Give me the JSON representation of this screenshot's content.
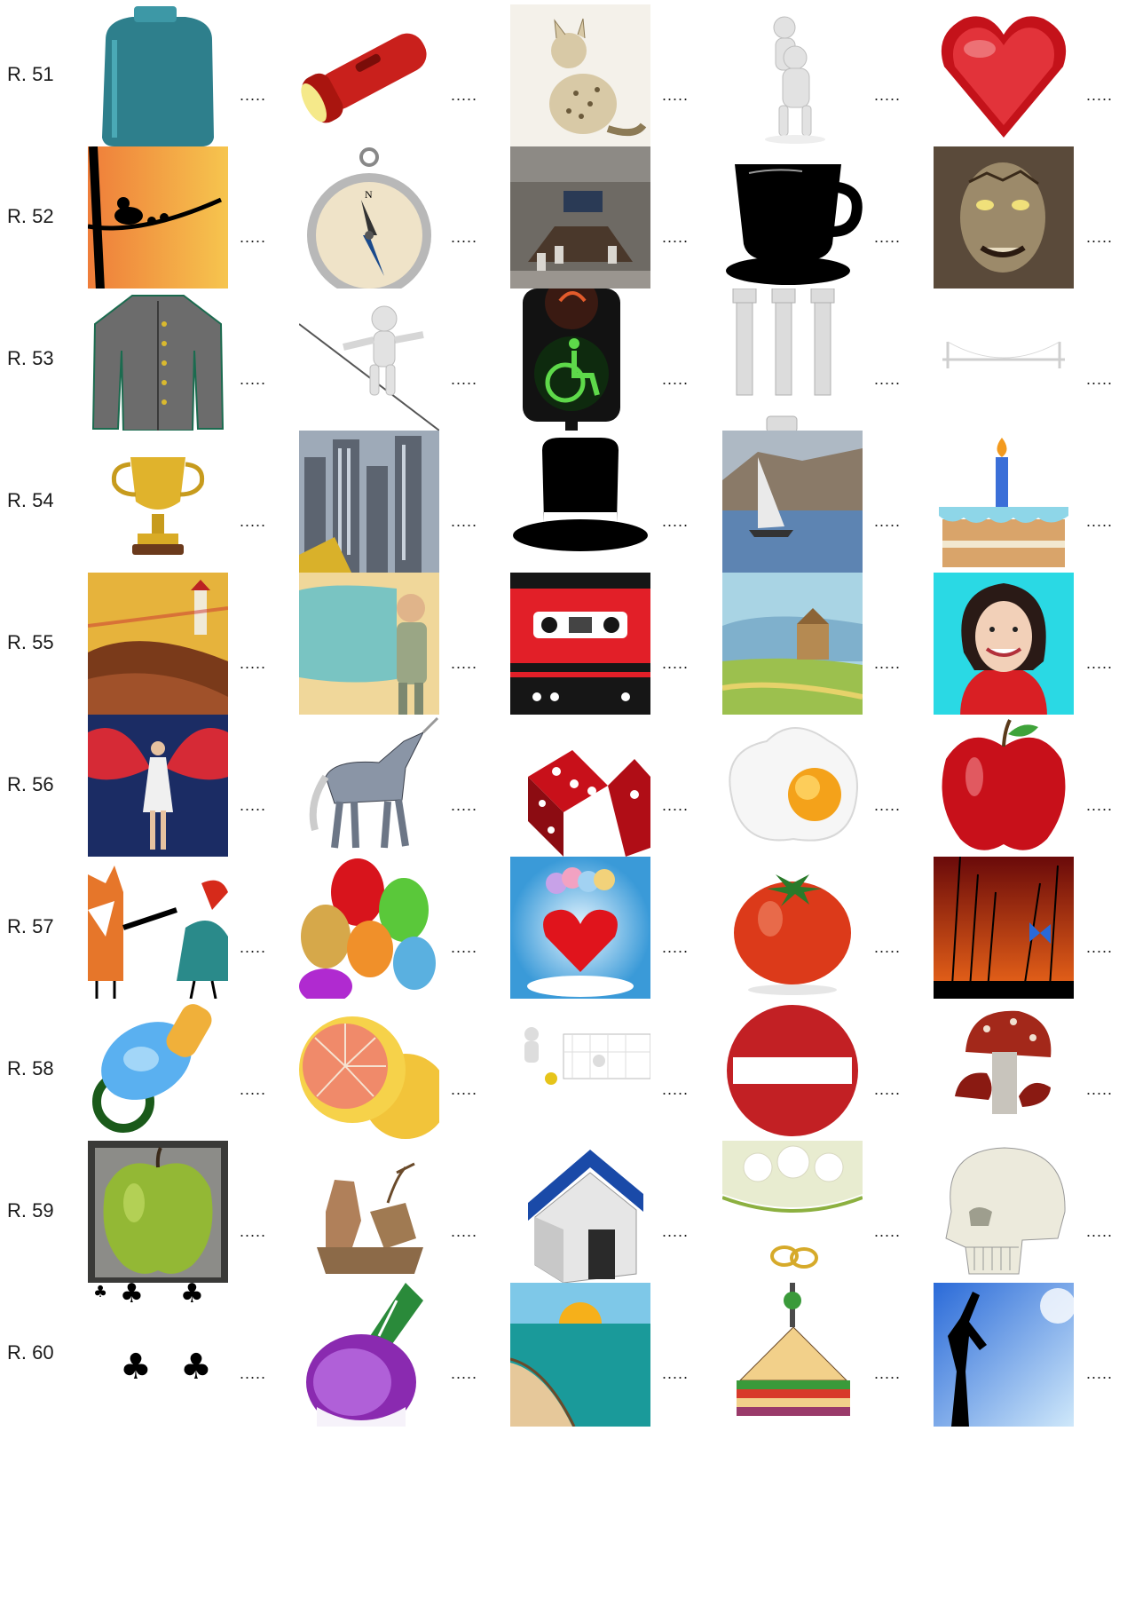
{
  "dots": ".....",
  "rows": [
    {
      "label": "R. 51",
      "items": [
        {
          "icon": "canister-icon"
        },
        {
          "icon": "flashlight-icon"
        },
        {
          "icon": "spotted-cat-icon"
        },
        {
          "icon": "figure-carrying-figure-icon"
        },
        {
          "icon": "red-heart-icon"
        }
      ]
    },
    {
      "label": "R. 52",
      "items": [
        {
          "icon": "bird-on-branch-icon"
        },
        {
          "icon": "compass-icon"
        },
        {
          "icon": "meeting-room-icon"
        },
        {
          "icon": "black-cup-icon"
        },
        {
          "icon": "monster-face-icon"
        }
      ]
    },
    {
      "label": "R. 53",
      "items": [
        {
          "icon": "grey-jacket-icon"
        },
        {
          "icon": "tightrope-walker-icon"
        },
        {
          "icon": "wheelchair-signal-icon"
        },
        {
          "icon": "bolts-icon"
        },
        {
          "icon": "suspension-bridge-icon"
        }
      ]
    },
    {
      "label": "R. 54",
      "items": [
        {
          "icon": "trophy-icon"
        },
        {
          "icon": "skyscrapers-icon"
        },
        {
          "icon": "top-hat-icon"
        },
        {
          "icon": "sailboat-puzzle-icon"
        },
        {
          "icon": "birthday-cake-icon"
        }
      ]
    },
    {
      "label": "R. 55",
      "items": [
        {
          "icon": "lighthouse-painting-icon"
        },
        {
          "icon": "painter-figurine-icon"
        },
        {
          "icon": "cassette-tape-icon"
        },
        {
          "icon": "landscape-painting-icon"
        },
        {
          "icon": "woman-portrait-icon"
        }
      ]
    },
    {
      "label": "R. 56",
      "items": [
        {
          "icon": "winged-woman-icon"
        },
        {
          "icon": "robot-unicorn-icon"
        },
        {
          "icon": "red-dice-icon"
        },
        {
          "icon": "fried-egg-icon"
        },
        {
          "icon": "red-apple-icon"
        }
      ]
    },
    {
      "label": "R. 57",
      "items": [
        {
          "icon": "fox-and-rooster-icon"
        },
        {
          "icon": "balloons-icon"
        },
        {
          "icon": "heart-balloons-icon"
        },
        {
          "icon": "tomato-icon"
        },
        {
          "icon": "butterfly-sunset-icon"
        }
      ]
    },
    {
      "label": "R. 58",
      "items": [
        {
          "icon": "pacifier-icon"
        },
        {
          "icon": "grapefruit-icon"
        },
        {
          "icon": "soccer-goal-icon"
        },
        {
          "icon": "no-entry-sign-icon"
        },
        {
          "icon": "mushrooms-icon"
        }
      ]
    },
    {
      "label": "R. 59",
      "items": [
        {
          "icon": "green-apple-icon"
        },
        {
          "icon": "deer-group-icon"
        },
        {
          "icon": "house-icon"
        },
        {
          "icon": "wedding-rings-icon"
        },
        {
          "icon": "skull-icon"
        }
      ]
    },
    {
      "label": "R. 60",
      "items": [
        {
          "icon": "five-of-clubs-card-icon"
        },
        {
          "icon": "turnip-icon"
        },
        {
          "icon": "beach-sunset-icon"
        },
        {
          "icon": "sandwich-icon"
        },
        {
          "icon": "yoga-silhouette-icon"
        }
      ]
    }
  ]
}
